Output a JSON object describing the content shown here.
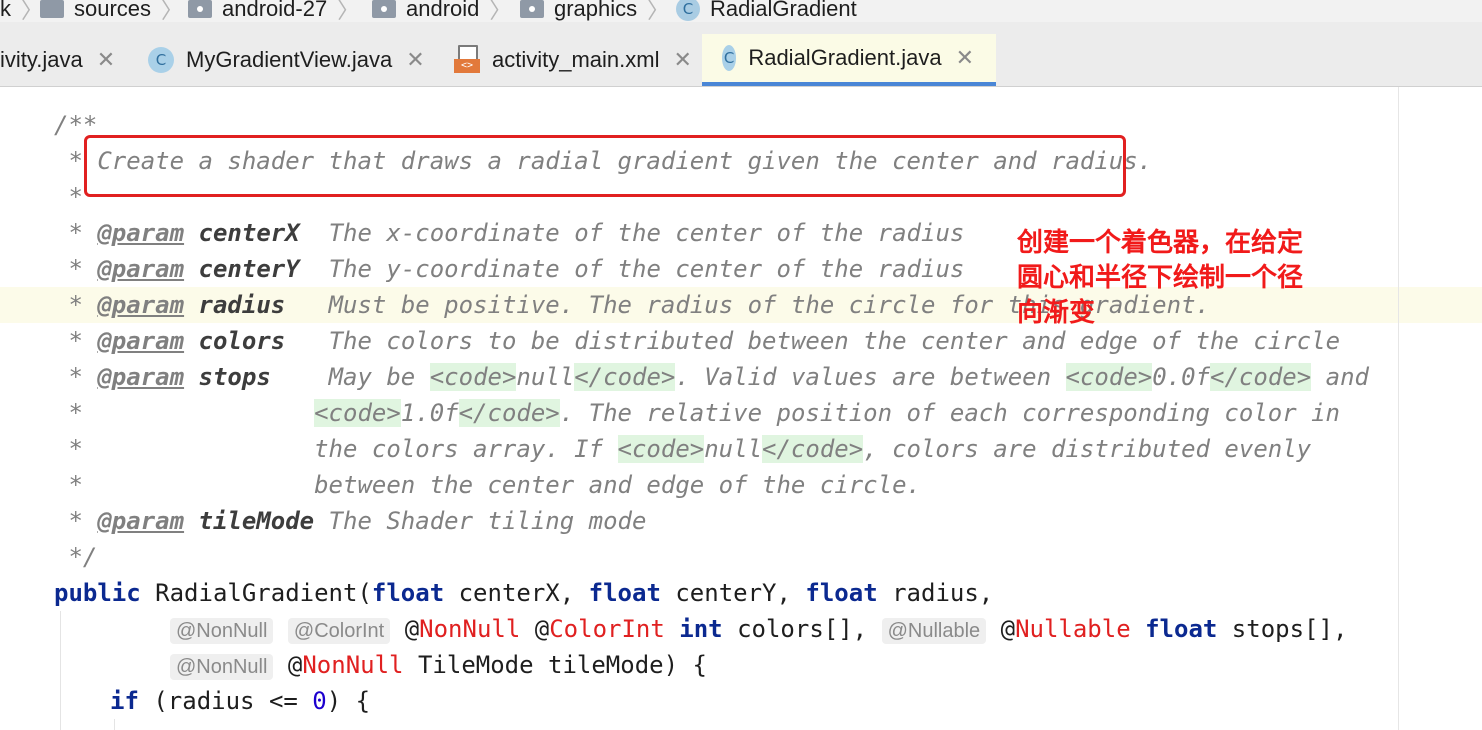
{
  "breadcrumb": {
    "items": [
      "k",
      "sources",
      "android-27",
      "android",
      "graphics",
      "RadialGradient"
    ]
  },
  "tabs": [
    {
      "label": "ivity.java"
    },
    {
      "label": "MyGradientView.java"
    },
    {
      "label": "activity_main.xml"
    },
    {
      "label": "RadialGradient.java",
      "active": true
    }
  ],
  "editor": {
    "lines": {
      "l0": "/**",
      "l1_star": " * ",
      "l1_text": "Create a shader that draws a radial gradient given the center and radius.",
      "l2": " *",
      "p1_name": "centerX",
      "p1_desc": "  The x-coordinate of the center of the radius",
      "p2_name": "centerY",
      "p2_desc": "  The y-coordinate of the center of the radius",
      "p3_name": "radius",
      "p3_desc": "   Must be positive. The radius of the circle for this gradient.",
      "p4_name": "colors",
      "p4_desc": "   The colors to be distributed between the center and edge of the circle",
      "p5_name": "stops",
      "p5_desc_a": "    May be ",
      "p5_desc_b": ". Valid values are between ",
      "p5_desc_c": " and",
      "cont1_b": ". The relative position of each corresponding color in",
      "cont2_a": "the colors array. If ",
      "cont2_b": ", colors are distributed evenly",
      "cont3": "between the center and edge of the circle.",
      "p6_name": "tileMode",
      "p6_desc": " The Shader tiling mode",
      "end": " */",
      "sig_public": "public",
      "sig_rest": " RadialGradient(",
      "sig_float": "float",
      "sig_cx": " centerX, ",
      "sig_cy": " centerY, ",
      "sig_r": " radius,",
      "hint_nonnull": "@NonNull",
      "hint_colorint": "@ColorInt",
      "hint_nullable": "@Nullable",
      "ann_nonnull": "NonNull",
      "ann_colorint": "ColorInt",
      "ann_nullable": "Nullable",
      "kw_int": "int",
      "colors_arr": " colors[], ",
      "stops_arr": " stops[],",
      "tilemode": " TileMode tileMode) {",
      "if_kw": "if",
      "if_rest_a": " (radius <= ",
      "if_zero": "0",
      "if_rest_b": ") {"
    },
    "param_tag": "@param",
    "code_open": "<code>",
    "code_close": "</code>",
    "v_null": "null",
    "v_zero": "0.0f",
    "v_one": "1.0f",
    "star": " *"
  },
  "annotation_note": "创建一个着色器，在给定圆心和半径下绘制一个径向渐变"
}
